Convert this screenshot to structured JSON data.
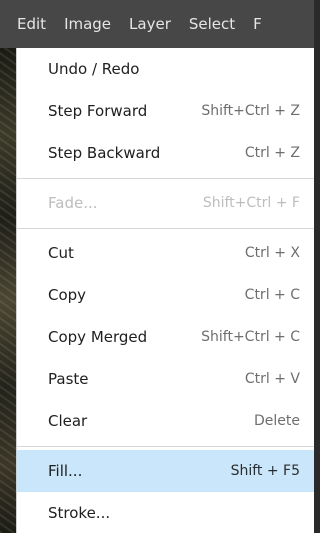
{
  "menubar": {
    "items": [
      {
        "label": "Edit"
      },
      {
        "label": "Image"
      },
      {
        "label": "Layer"
      },
      {
        "label": "Select"
      },
      {
        "label": "F"
      }
    ]
  },
  "edit_menu": {
    "items": [
      {
        "label": "Undo / Redo",
        "shortcut": ""
      },
      {
        "label": "Step Forward",
        "shortcut": "Shift+Ctrl + Z"
      },
      {
        "label": "Step Backward",
        "shortcut": "Ctrl + Z"
      },
      {
        "label": "Fade...",
        "shortcut": "Shift+Ctrl + F",
        "disabled": true
      },
      {
        "label": "Cut",
        "shortcut": "Ctrl + X"
      },
      {
        "label": "Copy",
        "shortcut": "Ctrl + C"
      },
      {
        "label": "Copy Merged",
        "shortcut": "Shift+Ctrl + C"
      },
      {
        "label": "Paste",
        "shortcut": "Ctrl + V"
      },
      {
        "label": "Clear",
        "shortcut": "Delete"
      },
      {
        "label": "Fill...",
        "shortcut": "Shift + F5",
        "highlighted": true
      },
      {
        "label": "Stroke...",
        "shortcut": ""
      }
    ]
  },
  "colors": {
    "menubar_bg": "#474747",
    "menu_bg": "#ffffff",
    "highlight": "#c9e6fb",
    "disabled_text": "#bdbdbd"
  }
}
